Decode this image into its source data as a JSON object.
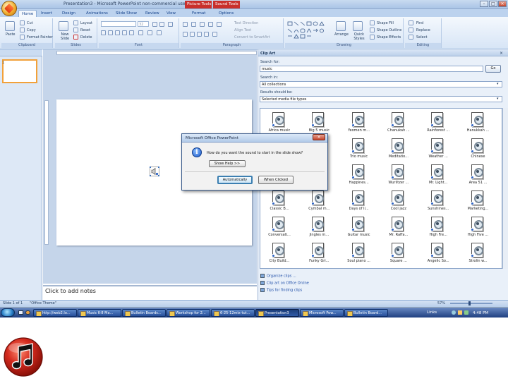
{
  "window": {
    "title": "Presentation3 - Microsoft PowerPoint non-commercial use",
    "contextual_tabs": [
      "Picture Tools",
      "Sound Tools"
    ],
    "controls": [
      "–",
      "□",
      "×"
    ]
  },
  "ribbon": {
    "tabs": [
      {
        "label": "Home",
        "active": true
      },
      {
        "label": "Insert"
      },
      {
        "label": "Design"
      },
      {
        "label": "Animations"
      },
      {
        "label": "Slide Show"
      },
      {
        "label": "Review"
      },
      {
        "label": "View"
      },
      {
        "label": "Format"
      },
      {
        "label": "Options"
      }
    ],
    "clipboard": {
      "paste": "Paste",
      "cut": "Cut",
      "copy": "Copy",
      "format_painter": "Format Painter",
      "label": "Clipboard"
    },
    "slides": {
      "new_slide": "New Slide",
      "layout": "Layout",
      "reset": "Reset",
      "delete": "Delete",
      "label": "Slides"
    },
    "font": {
      "label": "Font",
      "font_size": "32"
    },
    "paragraph": {
      "text_direction": "Text Direction",
      "align_text": "Align Text",
      "convert": "Convert to SmartArt",
      "label": "Paragraph"
    },
    "drawing": {
      "arrange": "Arrange",
      "quick_styles": "Quick Styles",
      "shape_fill": "Shape Fill",
      "shape_outline": "Shape Outline",
      "shape_effects": "Shape Effects",
      "label": "Drawing"
    },
    "editing": {
      "find": "Find",
      "replace": "Replace",
      "select": "Select",
      "label": "Editing"
    }
  },
  "notes": {
    "placeholder": "Click to add notes"
  },
  "clip_art": {
    "title": "Clip Art",
    "search_for_label": "Search for:",
    "search_value": "music",
    "go_label": "Go",
    "search_in_label": "Search in:",
    "search_in_value": "All collections",
    "results_label": "Results should be:",
    "results_value": "Selected media file types",
    "items": [
      "Africa music",
      "Big 5 music",
      "Yeomen m...",
      "Chanukah ...",
      "Rainforest ...",
      "Hanukkah ...",
      "Boogie w...",
      "Fanfare",
      "Trio music",
      "Meditatio...",
      "Weather ...",
      "Chinese",
      "Big band ...",
      "Band ...",
      "Happines...",
      "Wurlitzer ...",
      "Mr. Light...",
      "Area 51 ...",
      "Classic B...",
      "Cymbal m...",
      "Days of li...",
      "Cool jazz",
      "Sunshines...",
      "Marketing...",
      "Conversati...",
      "Jingles m...",
      "Guitar music",
      "Mr. Raffa...",
      "High Fre...",
      "High Five ...",
      "City Build...",
      "Funky Gri...",
      "Soul piano ...",
      "Square ...",
      "Angelic So...",
      "Strolin w..."
    ],
    "links": [
      "Organize clips ...",
      "Clip art on Office Online",
      "Tips for finding clips"
    ]
  },
  "status": {
    "slide": "Slide 1 of 1",
    "theme": "\"Office Theme\"",
    "zoom": "57%"
  },
  "dialog": {
    "title": "Microsoft Office PowerPoint",
    "message": "How do you want the sound to start in the slide show?",
    "show_help": "Show Help >>",
    "automatically": "Automatically",
    "when_clicked": "When Clicked"
  },
  "taskbar": {
    "items": [
      {
        "label": "http://web2.lo..."
      },
      {
        "label": "Music K-8 Ma..."
      },
      {
        "label": "Bulletin Boards..."
      },
      {
        "label": "Workshop for 2..."
      },
      {
        "label": "6-25-12mix-tut..."
      },
      {
        "label": "Presentation3",
        "active": true
      },
      {
        "label": "Microsoft Pow..."
      },
      {
        "label": "Bulletin Board..."
      }
    ],
    "links_label": "Links",
    "clock": "4:48 PM"
  },
  "colors": {
    "accent": "#1f3f80",
    "ribbon": "#d7e5f6",
    "music_icon_red": "#d42a1e"
  }
}
